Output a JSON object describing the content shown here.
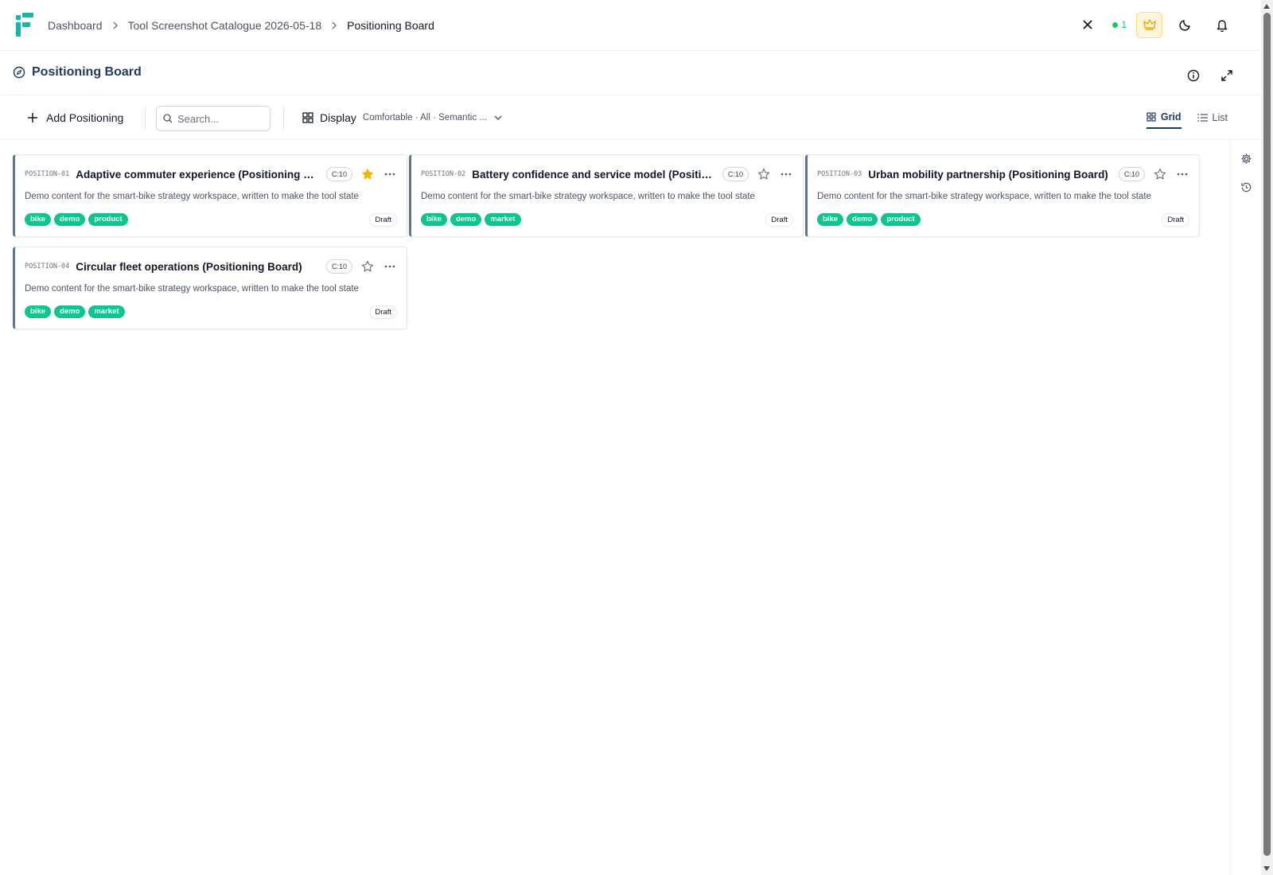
{
  "header": {
    "breadcrumb": [
      "Dashboard",
      "Tool Screenshot Catalogue 2026-05-18",
      "Positioning Board"
    ],
    "presence_count": "1"
  },
  "page": {
    "title": "Positioning Board"
  },
  "toolbar": {
    "add_label": "Add Positioning",
    "search_placeholder": "Search...",
    "display_label": "Display",
    "display_summary": "Comfortable · All · Semantic ...",
    "view_grid": "Grid",
    "view_list": "List"
  },
  "colors": {
    "brand": "#14b8a6",
    "accent": "#1e3a5f",
    "tag": "#10c48f",
    "star_active": "#f5b400"
  },
  "cards": [
    {
      "code": "POSITION-01",
      "title": "Adaptive commuter experience (Positioning B...",
      "chip": "C:10",
      "starred": true,
      "description": "Demo content for the smart-bike strategy workspace, written to make the tool state visible in catalogue screenshots.",
      "tags": [
        "bike",
        "demo",
        "product"
      ],
      "status": "Draft"
    },
    {
      "code": "POSITION-02",
      "title": "Battery confidence and service model (Positio...",
      "chip": "C:10",
      "starred": false,
      "description": "Demo content for the smart-bike strategy workspace, written to make the tool state visible in catalogue screenshots.",
      "tags": [
        "bike",
        "demo",
        "market"
      ],
      "status": "Draft"
    },
    {
      "code": "POSITION-03",
      "title": "Urban mobility partnership (Positioning Board)",
      "chip": "C:10",
      "starred": false,
      "description": "Demo content for the smart-bike strategy workspace, written to make the tool state visible in catalogue screenshots.",
      "tags": [
        "bike",
        "demo",
        "product"
      ],
      "status": "Draft"
    },
    {
      "code": "POSITION-04",
      "title": "Circular fleet operations (Positioning Board)",
      "chip": "C:10",
      "starred": false,
      "description": "Demo content for the smart-bike strategy workspace, written to make the tool state visible in catalogue screenshots.",
      "tags": [
        "bike",
        "demo",
        "market"
      ],
      "status": "Draft"
    }
  ]
}
